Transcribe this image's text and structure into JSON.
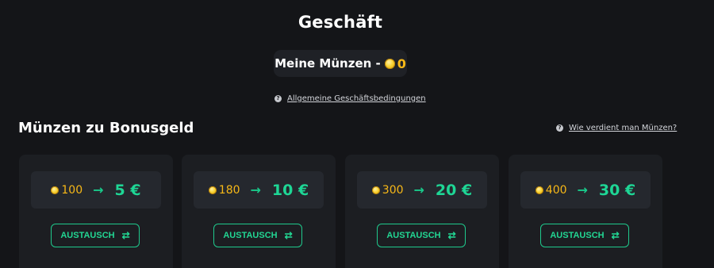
{
  "header": {
    "title": "Geschäft"
  },
  "balance": {
    "label": "Meine Münzen -",
    "value": "0",
    "icon": "coin-icon"
  },
  "links": {
    "terms": "Allgemeine Geschäftsbedingungen",
    "earn": "Wie verdient man Münzen?",
    "icon": "help-icon"
  },
  "section": {
    "title": "Münzen zu Bonusgeld"
  },
  "offers": [
    {
      "coins": "100",
      "arrow": "→",
      "amount": "5 €",
      "button": "AUSTAUSCH",
      "button_icon": "⇄"
    },
    {
      "coins": "180",
      "arrow": "→",
      "amount": "10 €",
      "button": "AUSTAUSCH",
      "button_icon": "⇄"
    },
    {
      "coins": "300",
      "arrow": "→",
      "amount": "20 €",
      "button": "AUSTAUSCH",
      "button_icon": "⇄"
    },
    {
      "coins": "400",
      "arrow": "→",
      "amount": "30 €",
      "button": "AUSTAUSCH",
      "button_icon": "⇄"
    }
  ],
  "colors": {
    "background": "#141518",
    "card": "#1c1e22",
    "coin": "#f7b817",
    "accent": "#1ed695"
  }
}
